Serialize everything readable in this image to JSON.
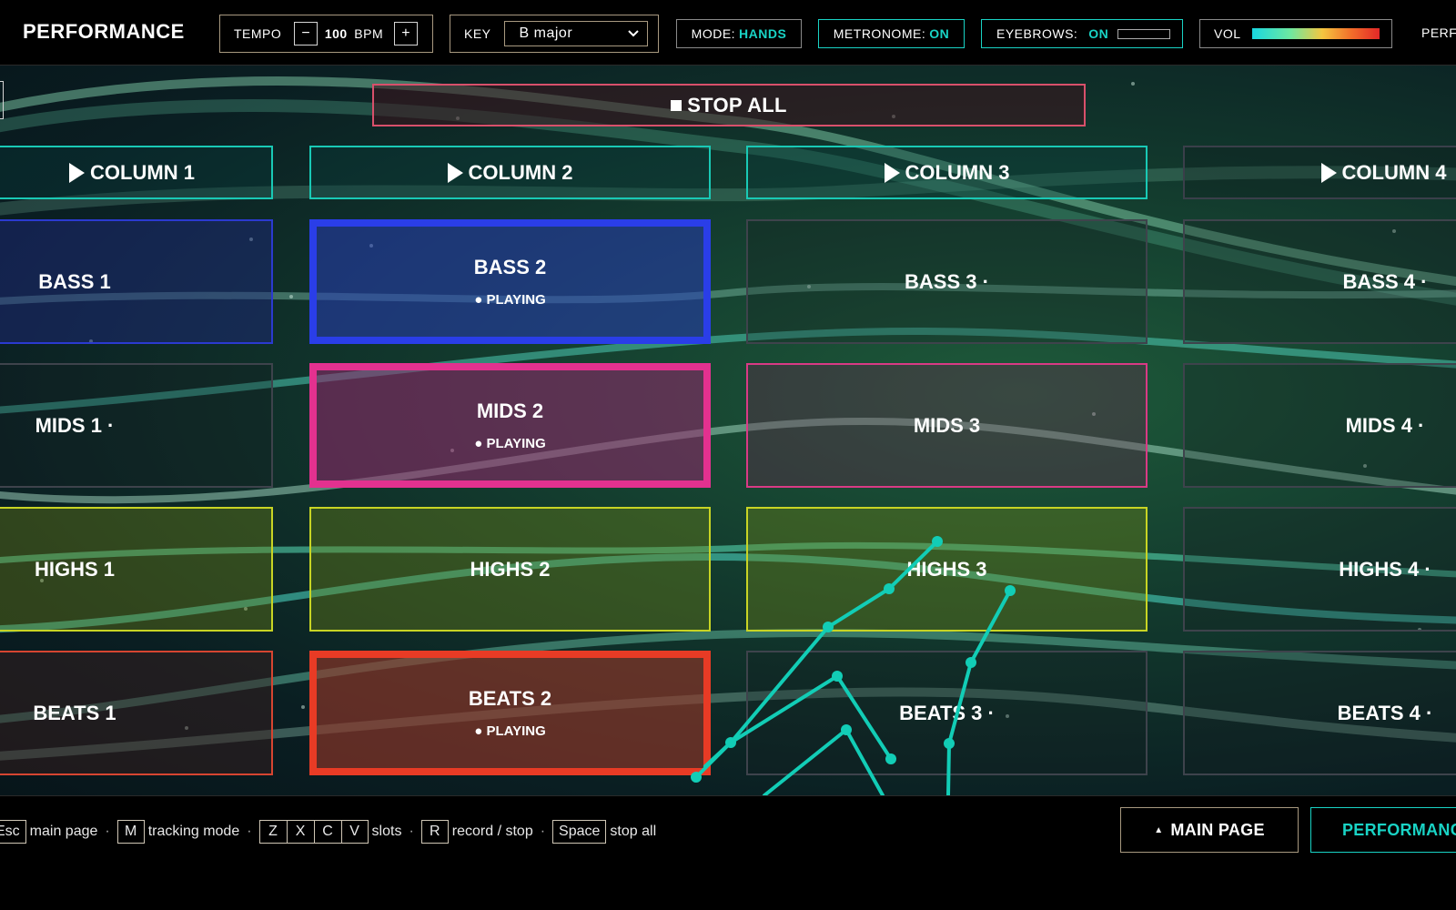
{
  "header": {
    "brand": "PERFORMANCE",
    "tempo": {
      "label": "TEMPO",
      "minus": "−",
      "value": "100",
      "unit": "BPM",
      "plus": "+"
    },
    "key": {
      "label": "KEY",
      "value": "B major"
    },
    "mode": {
      "label": "MODE:",
      "value": "HANDS"
    },
    "metronome": {
      "label": "METRONOME:",
      "value": "ON"
    },
    "eyebrows": {
      "label": "EYEBROWS:",
      "value": "ON"
    },
    "volume": {
      "label": "VOL"
    },
    "right_cut": "PERF"
  },
  "stage": {
    "stop_all": "STOP ALL",
    "columns": [
      "COLUMN 1",
      "COLUMN 2",
      "COLUMN 3",
      "COLUMN 4"
    ],
    "rows": [
      [
        "BASS 1",
        "BASS 2",
        "BASS 3 ·",
        "BASS 4 ·"
      ],
      [
        "MIDS 1 ·",
        "MIDS 2",
        "MIDS 3",
        "MIDS 4 ·"
      ],
      [
        "HIGHS 1",
        "HIGHS 2",
        "HIGHS 3",
        "HIGHS 4 ·"
      ],
      [
        "BEATS 1",
        "BEATS 2",
        "BEATS 3 ·",
        "BEATS 4 ·"
      ]
    ],
    "playing_label": "● PLAYING"
  },
  "footer": {
    "hints": {
      "esc_key": "Esc",
      "esc_text": "main page",
      "m_key": "M",
      "m_text": "tracking mode",
      "slot_keys": [
        "Z",
        "X",
        "C",
        "V"
      ],
      "slot_text": "slots",
      "r_key": "R",
      "r_text": "record / stop",
      "space_key": "Space",
      "space_text": "stop all"
    },
    "main_page_button": "MAIN PAGE",
    "performance_button": "PERFORMANCE"
  },
  "colors": {
    "accent": "#19d3c5",
    "bass": "#2a3ee8",
    "mids": "#e3318f",
    "highs": "#c8d424",
    "beats": "#e83b25"
  }
}
